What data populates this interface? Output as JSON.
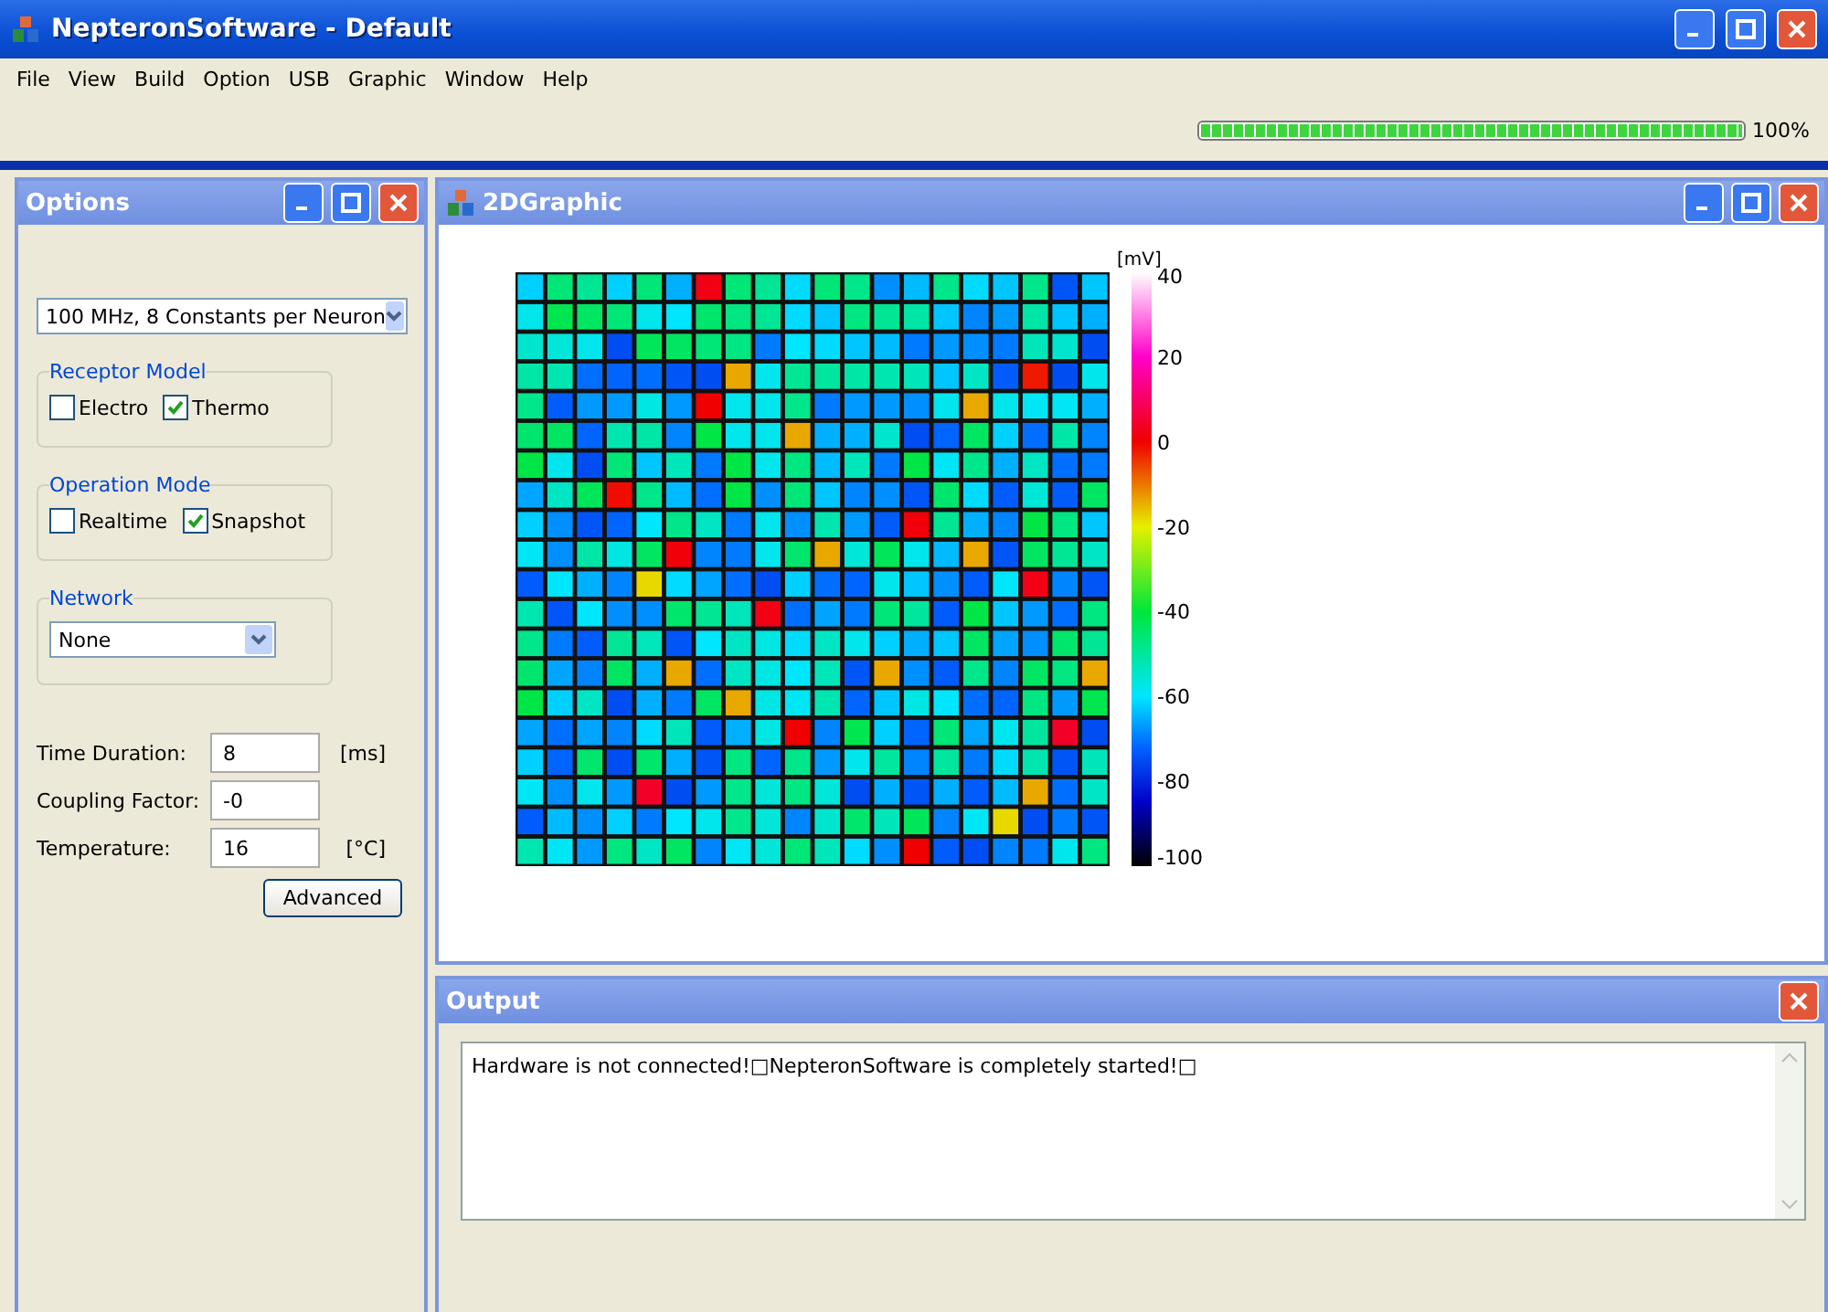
{
  "window": {
    "title": "NepteronSoftware - Default"
  },
  "menu": [
    "File",
    "View",
    "Build",
    "Option",
    "USB",
    "Graphic",
    "Window",
    "Help"
  ],
  "progress": {
    "level": 1,
    "reading": "100%"
  },
  "options_panel": {
    "title": "Options",
    "clock_select": {
      "value": "100 MHz, 8 Constants per Neuron"
    },
    "groups": [
      {
        "title": "Receptor Model",
        "checkboxes": [
          {
            "label": "Electro",
            "checked": false
          },
          {
            "label": "Thermo",
            "checked": true
          }
        ]
      },
      {
        "title": "Operation Mode",
        "checkboxes": [
          {
            "label": "Realtime",
            "checked": false
          },
          {
            "label": "Snapshot",
            "checked": true
          }
        ]
      }
    ],
    "network": {
      "title": "Network",
      "value": "None"
    },
    "fields": [
      {
        "label": "Time Duration:",
        "value": "8",
        "unit": "[ms]"
      },
      {
        "label": "Coupling Factor:",
        "value": "-0"
      },
      {
        "label": "Temperature:",
        "value": "16",
        "unit": "[°C]"
      }
    ],
    "advanced_button": "Advanced"
  },
  "graphic_panel": {
    "title": "2DGraphic",
    "colorbar": {
      "unit": "[mV]",
      "ticks": [
        "40",
        "20",
        "0",
        "-20",
        "-40",
        "-60",
        "-80",
        "-100"
      ]
    }
  },
  "output_panel": {
    "title": "Output",
    "text": "Hardware is not connected!□NepteronSoftware is completely started!□"
  }
}
